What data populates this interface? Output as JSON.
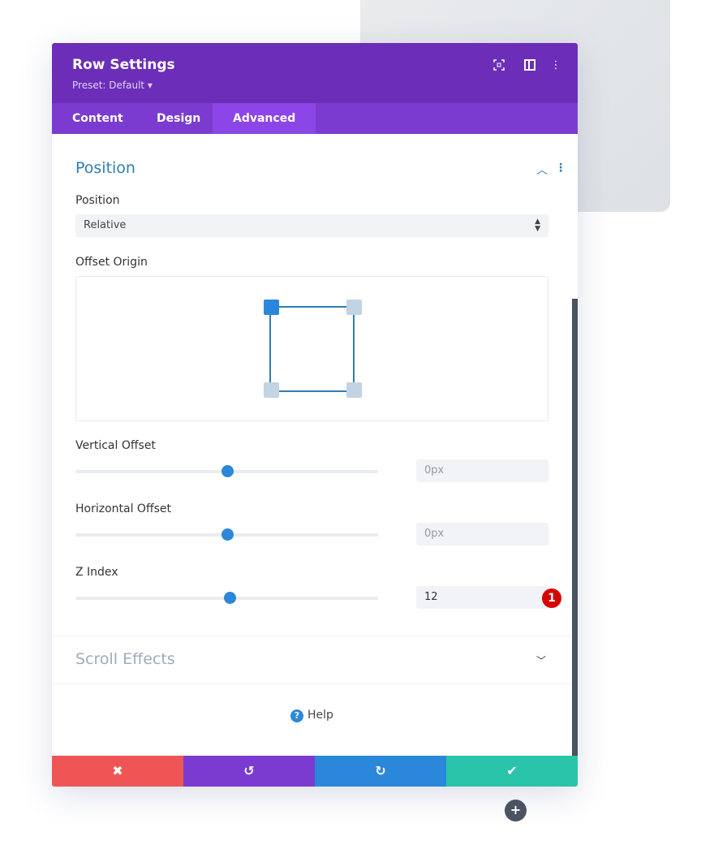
{
  "header": {
    "title": "Row Settings",
    "preset": "Preset: Default ▾",
    "icons": [
      "fullscreen-icon",
      "split-view-icon",
      "more-options-icon"
    ]
  },
  "tabs": [
    {
      "label": "Content"
    },
    {
      "label": "Design"
    },
    {
      "label": "Advanced",
      "active": true
    }
  ],
  "position_section": {
    "title": "Position",
    "position_label": "Position",
    "position_value": "Relative",
    "offset_origin_label": "Offset Origin",
    "offset_origin_selected": "top-left",
    "vertical_offset": {
      "label": "Vertical Offset",
      "placeholder": "0px",
      "slider": 0.5
    },
    "horizontal_offset": {
      "label": "Horizontal Offset",
      "placeholder": "0px",
      "slider": 0.5
    },
    "z_index": {
      "label": "Z Index",
      "value": "12",
      "slider": 0.51,
      "badge": "1"
    }
  },
  "scroll_section": {
    "title": "Scroll Effects"
  },
  "help": {
    "label": "Help"
  },
  "footer": {
    "cancel": "✖",
    "undo": "↺",
    "redo": "↻",
    "save": "✔"
  },
  "colors": {
    "header": "#6c2eb9",
    "tabs": "#7b3bd0",
    "cancel": "#ef5555",
    "undo": "#7b3bd0",
    "redo": "#2b87da",
    "save": "#29c4a9",
    "accent": "#2b87da"
  }
}
